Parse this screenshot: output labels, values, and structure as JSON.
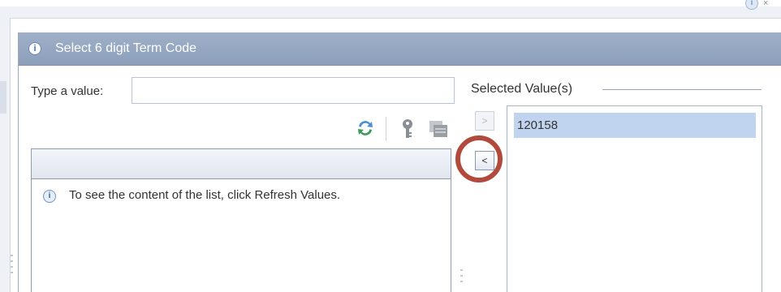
{
  "dialog": {
    "title": "Select 6 digit Term Code",
    "header_icon": "info-icon"
  },
  "search": {
    "label": "Type a value:",
    "value": "",
    "placeholder": ""
  },
  "toolbar": {
    "icons": [
      "refresh-icon",
      "key-icon",
      "stack-icon"
    ]
  },
  "available_list": {
    "message": "To see the content of the list, click Refresh Values.",
    "message_icon": "info-icon"
  },
  "arrows": {
    "add_label": ">",
    "remove_label": "<"
  },
  "selected": {
    "legend": "Selected Value(s)",
    "items": [
      "120158"
    ]
  },
  "colors": {
    "header_bg": "#9fb0c8",
    "selected_row": "#c1d4ef",
    "annotation_ring": "#b24a3c"
  }
}
